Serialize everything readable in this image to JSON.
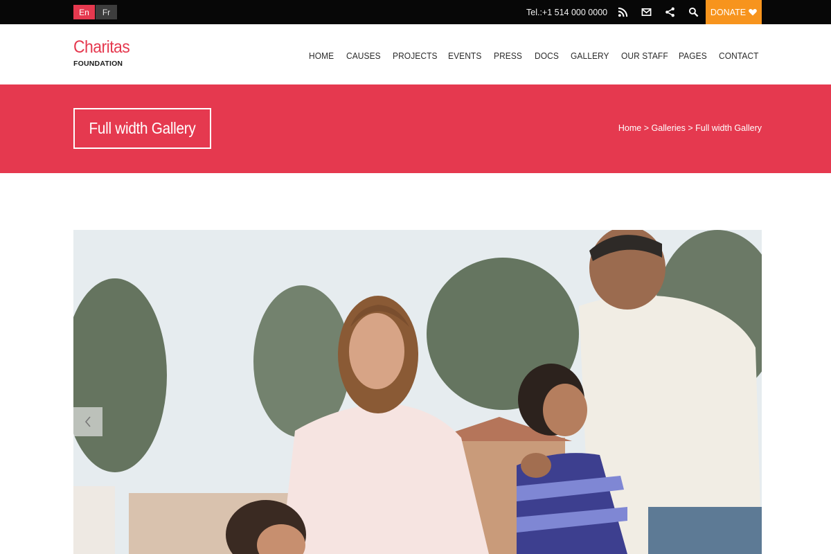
{
  "topbar": {
    "languages": [
      {
        "label": "En",
        "active": true
      },
      {
        "label": "Fr",
        "active": false
      }
    ],
    "phone": "Tel.:+1 514 000 0000",
    "icons": [
      "rss-icon",
      "mail-icon",
      "share-icon",
      "search-icon"
    ],
    "donate_label": "DONATE"
  },
  "brand": {
    "name": "Charitas",
    "tagline": "FOUNDATION"
  },
  "nav": {
    "items": [
      "HOME",
      "CAUSES",
      "PROJECTS",
      "EVENTS",
      "PRESS",
      "DOCS",
      "GALLERY",
      "OUR STAFF",
      "PAGES",
      "CONTACT"
    ]
  },
  "page": {
    "title": "Full width Gallery",
    "breadcrumb": [
      "Home",
      "Galleries",
      "Full width Gallery"
    ],
    "breadcrumb_separator": ">"
  },
  "gallery": {
    "image": "family-photo",
    "prev_icon": "chevron-left-icon"
  },
  "colors": {
    "accent": "#e5394f",
    "donate": "#f7941d",
    "topbar": "#070707"
  }
}
